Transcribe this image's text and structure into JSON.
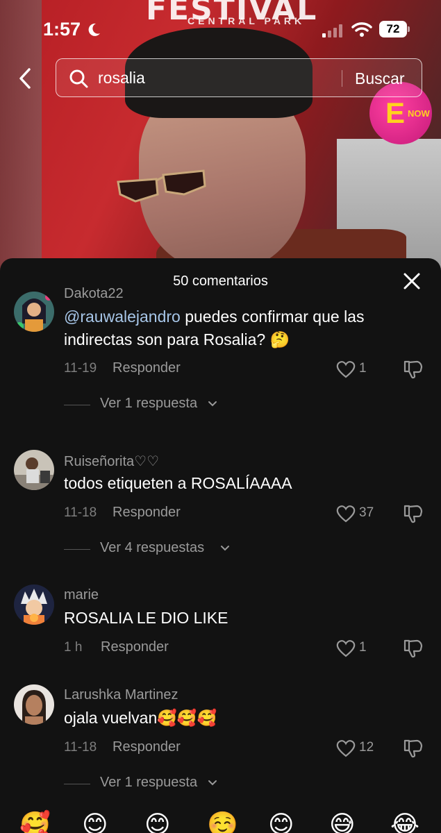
{
  "status_bar": {
    "time": "1:57",
    "battery": "72"
  },
  "video": {
    "background_text": "FESTIVAL",
    "background_subtext": "CENTRAL PARK",
    "badge_letter": "E",
    "badge_text": "NOW"
  },
  "search": {
    "query": "rosalia",
    "button_label": "Buscar"
  },
  "comments_sheet": {
    "title": "50 comentarios",
    "comments": [
      {
        "username": "Dakota22",
        "mention": "@rauwalejandro",
        "text": " puedes confirmar que las indirectas son para Rosalia? 🤔",
        "date": "11-19",
        "reply_label": "Responder",
        "likes": "1",
        "view_replies": "Ver 1 respuesta"
      },
      {
        "username": "Ruiseñorita♡♡",
        "text": "todos etiqueten a ROSALÍAAAA",
        "date": "11-18",
        "reply_label": "Responder",
        "likes": "37",
        "view_replies": "Ver 4 respuestas"
      },
      {
        "username": "marie",
        "text": "ROSALIA LE DIO LIKE",
        "date": "1 h",
        "reply_label": "Responder",
        "likes": "1"
      },
      {
        "username": "Larushka Martinez",
        "text": "ojala vuelvan🥰🥰🥰",
        "date": "11-18",
        "reply_label": "Responder",
        "likes": "12",
        "view_replies": "Ver 1 respuesta"
      }
    ]
  },
  "emoji_bar": [
    "🥰",
    "😊",
    "😊",
    "☺️",
    "😊",
    "😅",
    "😂"
  ],
  "colors": {
    "accent_mention": "#a7c6e8",
    "sheet_bg": "#121212",
    "video_red": "#c72b2f"
  }
}
